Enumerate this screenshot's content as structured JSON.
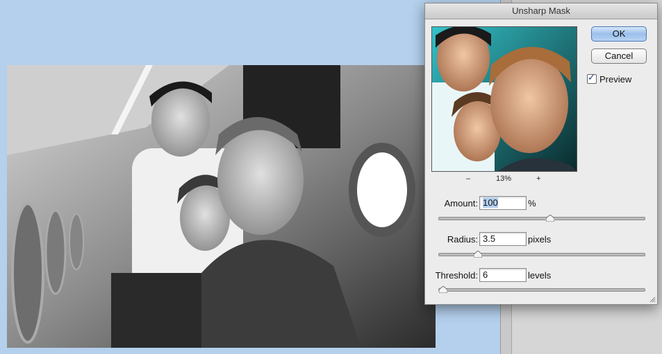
{
  "dialog": {
    "title": "Unsharp Mask",
    "ok_label": "OK",
    "cancel_label": "Cancel",
    "preview_label": "Preview",
    "preview_checked": true,
    "zoom_out": "–",
    "zoom_level": "13%",
    "zoom_in": "+",
    "amount": {
      "label": "Amount:",
      "value": "100",
      "unit": "%",
      "slider_fraction": 0.54
    },
    "radius": {
      "label": "Radius:",
      "value": "3.5",
      "unit": "pixels",
      "slider_fraction": 0.19
    },
    "threshold": {
      "label": "Threshold:",
      "value": "6",
      "unit": "levels",
      "slider_fraction": 0.02
    }
  },
  "colors": {
    "desktop": "#b4d0ec",
    "dialog_bg": "#ececec",
    "default_button": "#9cc0ec"
  }
}
